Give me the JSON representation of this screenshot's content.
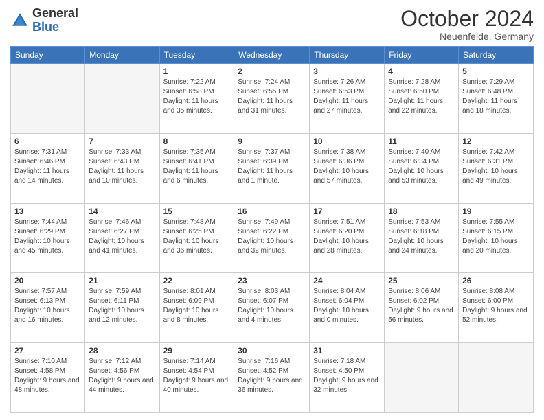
{
  "logo": {
    "general": "General",
    "blue": "Blue"
  },
  "header": {
    "month": "October 2024",
    "location": "Neuenfelde, Germany"
  },
  "weekdays": [
    "Sunday",
    "Monday",
    "Tuesday",
    "Wednesday",
    "Thursday",
    "Friday",
    "Saturday"
  ],
  "weeks": [
    [
      {
        "day": "",
        "info": ""
      },
      {
        "day": "",
        "info": ""
      },
      {
        "day": "1",
        "info": "Sunrise: 7:22 AM\nSunset: 6:58 PM\nDaylight: 11 hours and 35 minutes."
      },
      {
        "day": "2",
        "info": "Sunrise: 7:24 AM\nSunset: 6:55 PM\nDaylight: 11 hours and 31 minutes."
      },
      {
        "day": "3",
        "info": "Sunrise: 7:26 AM\nSunset: 6:53 PM\nDaylight: 11 hours and 27 minutes."
      },
      {
        "day": "4",
        "info": "Sunrise: 7:28 AM\nSunset: 6:50 PM\nDaylight: 11 hours and 22 minutes."
      },
      {
        "day": "5",
        "info": "Sunrise: 7:29 AM\nSunset: 6:48 PM\nDaylight: 11 hours and 18 minutes."
      }
    ],
    [
      {
        "day": "6",
        "info": "Sunrise: 7:31 AM\nSunset: 6:46 PM\nDaylight: 11 hours and 14 minutes."
      },
      {
        "day": "7",
        "info": "Sunrise: 7:33 AM\nSunset: 6:43 PM\nDaylight: 11 hours and 10 minutes."
      },
      {
        "day": "8",
        "info": "Sunrise: 7:35 AM\nSunset: 6:41 PM\nDaylight: 11 hours and 6 minutes."
      },
      {
        "day": "9",
        "info": "Sunrise: 7:37 AM\nSunset: 6:39 PM\nDaylight: 11 hours and 1 minute."
      },
      {
        "day": "10",
        "info": "Sunrise: 7:38 AM\nSunset: 6:36 PM\nDaylight: 10 hours and 57 minutes."
      },
      {
        "day": "11",
        "info": "Sunrise: 7:40 AM\nSunset: 6:34 PM\nDaylight: 10 hours and 53 minutes."
      },
      {
        "day": "12",
        "info": "Sunrise: 7:42 AM\nSunset: 6:31 PM\nDaylight: 10 hours and 49 minutes."
      }
    ],
    [
      {
        "day": "13",
        "info": "Sunrise: 7:44 AM\nSunset: 6:29 PM\nDaylight: 10 hours and 45 minutes."
      },
      {
        "day": "14",
        "info": "Sunrise: 7:46 AM\nSunset: 6:27 PM\nDaylight: 10 hours and 41 minutes."
      },
      {
        "day": "15",
        "info": "Sunrise: 7:48 AM\nSunset: 6:25 PM\nDaylight: 10 hours and 36 minutes."
      },
      {
        "day": "16",
        "info": "Sunrise: 7:49 AM\nSunset: 6:22 PM\nDaylight: 10 hours and 32 minutes."
      },
      {
        "day": "17",
        "info": "Sunrise: 7:51 AM\nSunset: 6:20 PM\nDaylight: 10 hours and 28 minutes."
      },
      {
        "day": "18",
        "info": "Sunrise: 7:53 AM\nSunset: 6:18 PM\nDaylight: 10 hours and 24 minutes."
      },
      {
        "day": "19",
        "info": "Sunrise: 7:55 AM\nSunset: 6:15 PM\nDaylight: 10 hours and 20 minutes."
      }
    ],
    [
      {
        "day": "20",
        "info": "Sunrise: 7:57 AM\nSunset: 6:13 PM\nDaylight: 10 hours and 16 minutes."
      },
      {
        "day": "21",
        "info": "Sunrise: 7:59 AM\nSunset: 6:11 PM\nDaylight: 10 hours and 12 minutes."
      },
      {
        "day": "22",
        "info": "Sunrise: 8:01 AM\nSunset: 6:09 PM\nDaylight: 10 hours and 8 minutes."
      },
      {
        "day": "23",
        "info": "Sunrise: 8:03 AM\nSunset: 6:07 PM\nDaylight: 10 hours and 4 minutes."
      },
      {
        "day": "24",
        "info": "Sunrise: 8:04 AM\nSunset: 6:04 PM\nDaylight: 10 hours and 0 minutes."
      },
      {
        "day": "25",
        "info": "Sunrise: 8:06 AM\nSunset: 6:02 PM\nDaylight: 9 hours and 56 minutes."
      },
      {
        "day": "26",
        "info": "Sunrise: 8:08 AM\nSunset: 6:00 PM\nDaylight: 9 hours and 52 minutes."
      }
    ],
    [
      {
        "day": "27",
        "info": "Sunrise: 7:10 AM\nSunset: 4:58 PM\nDaylight: 9 hours and 48 minutes."
      },
      {
        "day": "28",
        "info": "Sunrise: 7:12 AM\nSunset: 4:56 PM\nDaylight: 9 hours and 44 minutes."
      },
      {
        "day": "29",
        "info": "Sunrise: 7:14 AM\nSunset: 4:54 PM\nDaylight: 9 hours and 40 minutes."
      },
      {
        "day": "30",
        "info": "Sunrise: 7:16 AM\nSunset: 4:52 PM\nDaylight: 9 hours and 36 minutes."
      },
      {
        "day": "31",
        "info": "Sunrise: 7:18 AM\nSunset: 4:50 PM\nDaylight: 9 hours and 32 minutes."
      },
      {
        "day": "",
        "info": ""
      },
      {
        "day": "",
        "info": ""
      }
    ]
  ]
}
